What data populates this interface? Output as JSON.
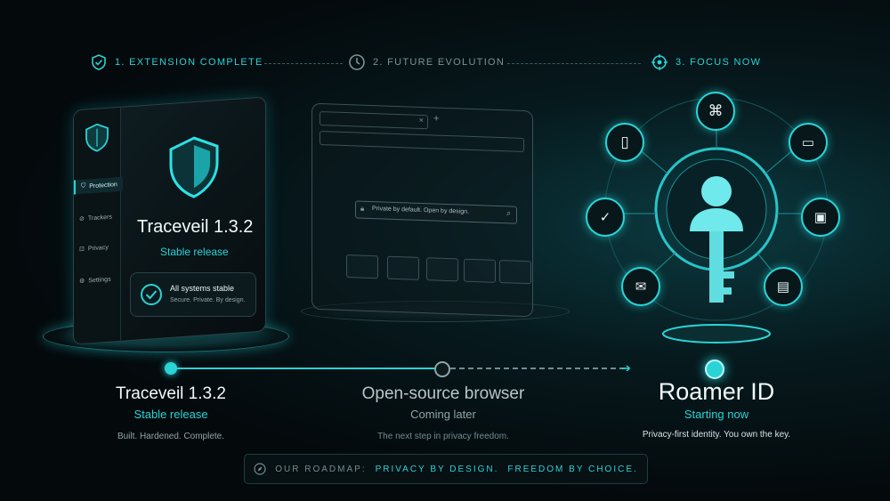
{
  "steps": [
    {
      "label": "1. EXTENSION COMPLETE",
      "icon": "shield-check-icon"
    },
    {
      "label": "2. FUTURE EVOLUTION",
      "icon": "clock-icon"
    },
    {
      "label": "3. FOCUS NOW",
      "icon": "target-icon"
    }
  ],
  "extension_panel": {
    "sidebar": [
      "Protection",
      "Trackers",
      "Privacy",
      "Settings"
    ],
    "title": "Traceveil 1.3.2",
    "subtitle": "Stable release",
    "status_title": "All systems stable",
    "status_text": "Secure. Private. By design."
  },
  "browser_panel": {
    "search_placeholder": "Private by default. Open by design."
  },
  "columns": [
    {
      "title": "Traceveil 1.3.2",
      "subtitle": "Stable release",
      "desc": "Built. Hardened. Complete."
    },
    {
      "title": "Open-source browser",
      "subtitle": "Coming later",
      "desc": "The next step in privacy freedom."
    },
    {
      "title": "Roamer ID",
      "subtitle": "Starting now",
      "desc": "Privacy-first identity. You own the key."
    }
  ],
  "footer": {
    "prefix": "OUR ROADMAP:",
    "part1": "PRIVACY BY DESIGN.",
    "part2": "FREEDOM BY CHOICE.",
    "icon": "compass-icon"
  },
  "colors": {
    "accent": "#29d3d6",
    "muted": "#8fa5a8",
    "bg": "#04090c"
  },
  "identity_icons": [
    "fingerprint-icon",
    "phone-icon",
    "laptop-icon",
    "shield-check-icon",
    "lock-icon",
    "mail-icon",
    "chat-icon",
    "user-key-icon"
  ]
}
